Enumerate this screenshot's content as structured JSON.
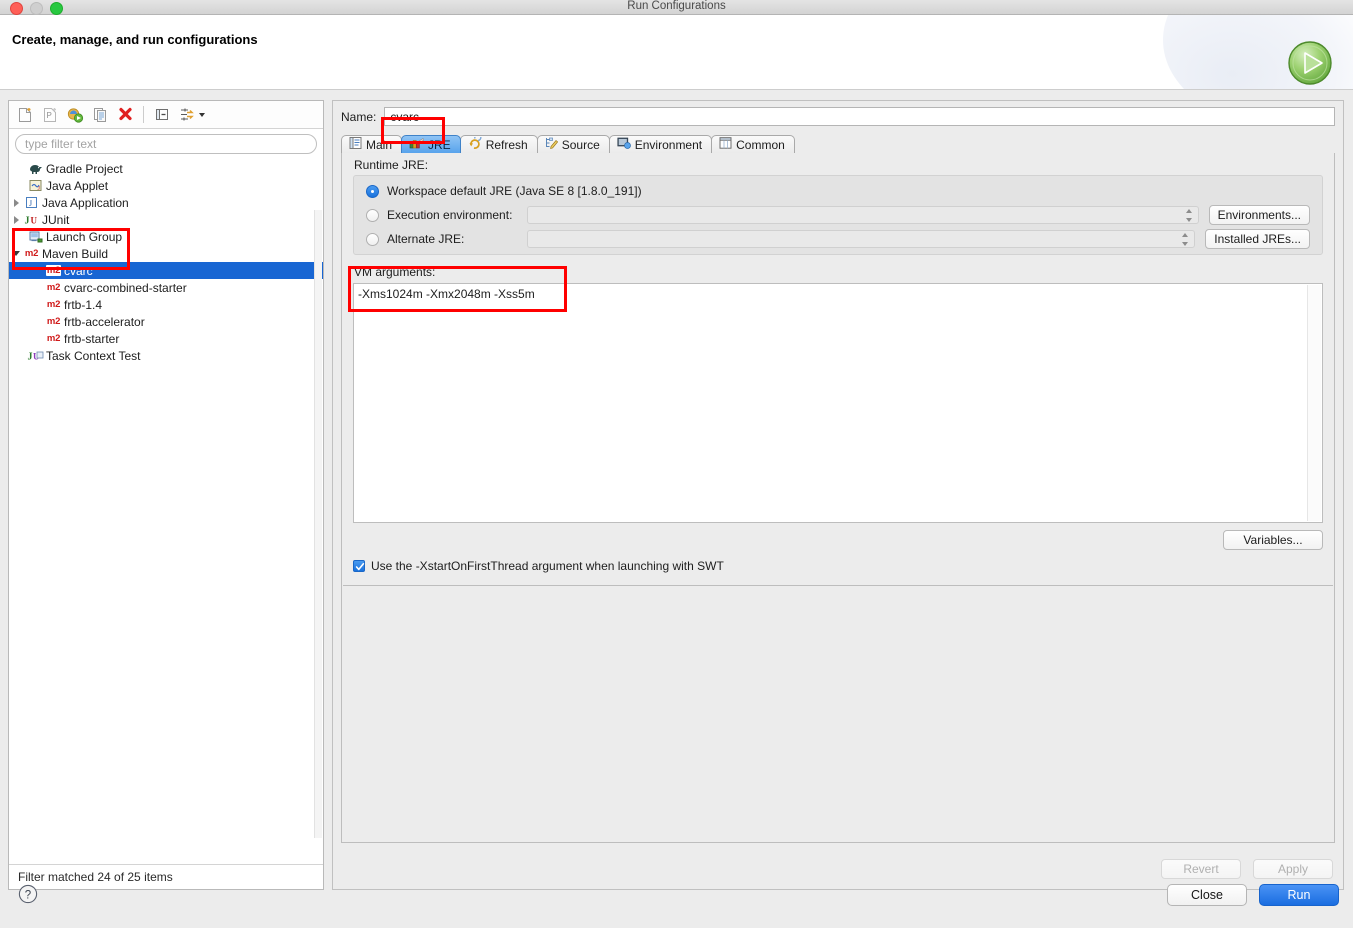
{
  "window": {
    "title": "Run Configurations",
    "traffic_lights": [
      "close-button",
      "minimize-button",
      "maximize-button"
    ]
  },
  "header": {
    "title": "Create, manage, and run configurations",
    "run_icon": "run-play-icon"
  },
  "left_panel": {
    "toolbar": [
      {
        "name": "new-configuration-icon",
        "tooltip": "New launch configuration"
      },
      {
        "name": "new-prototype-icon",
        "tooltip": "New prototype"
      },
      {
        "name": "export-configuration-icon",
        "tooltip": "Export"
      },
      {
        "name": "duplicate-configuration-icon",
        "tooltip": "Duplicate"
      },
      {
        "name": "delete-configuration-icon",
        "tooltip": "Delete"
      },
      {
        "name": "collapse-all-icon",
        "tooltip": "Collapse All"
      },
      {
        "name": "filter-configurations-icon",
        "tooltip": "Filter"
      }
    ],
    "filter": {
      "placeholder": "type filter text",
      "value": ""
    },
    "tree": [
      {
        "label": "Gradle Project",
        "icon": "gradle-elephant-icon",
        "indent": 0,
        "twisty": "none",
        "selected": false
      },
      {
        "label": "Java Applet",
        "icon": "java-applet-icon",
        "indent": 0,
        "twisty": "none",
        "selected": false
      },
      {
        "label": "Java Application",
        "icon": "java-application-icon",
        "indent": 0,
        "twisty": "collapsed",
        "selected": false
      },
      {
        "label": "JUnit",
        "icon": "junit-icon",
        "indent": 0,
        "twisty": "collapsed",
        "selected": false
      },
      {
        "label": "Launch Group",
        "icon": "launch-group-icon",
        "indent": 0,
        "twisty": "none",
        "selected": false
      },
      {
        "label": "Maven Build",
        "icon": "m2-icon",
        "indent": 0,
        "twisty": "expanded",
        "selected": false
      },
      {
        "label": "cvarc",
        "icon": "m2-icon",
        "indent": 1,
        "twisty": "none",
        "selected": true
      },
      {
        "label": "cvarc-combined-starter",
        "icon": "m2-icon",
        "indent": 1,
        "twisty": "none",
        "selected": false
      },
      {
        "label": "frtb-1.4",
        "icon": "m2-icon",
        "indent": 1,
        "twisty": "none",
        "selected": false
      },
      {
        "label": "frtb-accelerator",
        "icon": "m2-icon",
        "indent": 1,
        "twisty": "none",
        "selected": false
      },
      {
        "label": "frtb-starter",
        "icon": "m2-icon",
        "indent": 1,
        "twisty": "none",
        "selected": false
      },
      {
        "label": "Task Context Test",
        "icon": "junit-task-icon",
        "indent": 0,
        "twisty": "none",
        "selected": false
      }
    ],
    "status": "Filter matched 24 of 25 items"
  },
  "right_panel": {
    "name_label": "Name:",
    "name_value": "cvarc",
    "tabs": [
      {
        "label": "Main",
        "icon": "main-document-icon",
        "active": false
      },
      {
        "label": "JRE",
        "icon": "jre-books-icon",
        "active": true
      },
      {
        "label": "Refresh",
        "icon": "refresh-arrows-icon",
        "active": false
      },
      {
        "label": "Source",
        "icon": "source-pencil-icon",
        "active": false
      },
      {
        "label": "Environment",
        "icon": "environment-icon",
        "active": false
      },
      {
        "label": "Common",
        "icon": "common-table-icon",
        "active": false
      }
    ],
    "jre": {
      "section_label": "Runtime JRE:",
      "options": [
        {
          "label": "Workspace default JRE (Java SE 8 [1.8.0_191])",
          "selected": true,
          "has_combo": false,
          "button": null
        },
        {
          "label": "Execution environment:",
          "selected": false,
          "has_combo": true,
          "button": "Environments..."
        },
        {
          "label": "Alternate JRE:",
          "selected": false,
          "has_combo": true,
          "button": "Installed JREs..."
        }
      ]
    },
    "vm_arguments": {
      "label": "VM arguments:",
      "value": "-Xms1024m -Xmx2048m -Xss5m",
      "variables_button": "Variables..."
    },
    "swt_checkbox": {
      "label": "Use the -XstartOnFirstThread argument when launching with SWT",
      "checked": true
    },
    "revert_button": "Revert",
    "apply_button": "Apply"
  },
  "footer": {
    "help_icon": "help-question-icon",
    "close_button": "Close",
    "run_button": "Run"
  },
  "colors": {
    "selection_blue": "#1866d3",
    "annotation_red": "#ff0000",
    "primary_button": "#1a6de0",
    "maven_red": "#d01b1b"
  }
}
